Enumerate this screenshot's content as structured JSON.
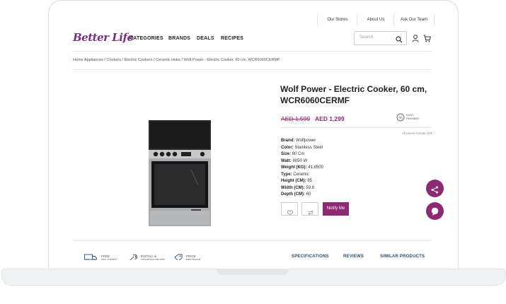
{
  "topbar": {
    "links": [
      "Our Stores",
      "About Us",
      "Ask Our Team"
    ]
  },
  "brand": {
    "logo_text": "Better Life",
    "accent_color": "#8e2a73"
  },
  "nav": {
    "items": [
      "CATEGORIES",
      "BRANDS",
      "DEALS",
      "RECIPES"
    ]
  },
  "search": {
    "placeholder": "Search"
  },
  "breadcrumb": "Home Appliances / Cookers / Electric Cookers / Ceramic Hobs / Wolf Power - Electric Cooker, 60 cm, WCR6060CERMF",
  "product": {
    "title": "Wolf Power - Electric Cooker, 60 cm, WCR6060CERMF",
    "old_price": "AED 1,599",
    "new_price": "AED 1,299",
    "easy_payment": "EASY PAYMENT",
    "vat_note": "All prices include VAT",
    "specs": [
      {
        "label": "Brand:",
        "value": "Wolfpower"
      },
      {
        "label": "Color:",
        "value": "Stainless Steel"
      },
      {
        "label": "Size:",
        "value": "60 Cm"
      },
      {
        "label": "Watt:",
        "value": "8050 W"
      },
      {
        "label": "Weight (KG):",
        "value": "41.8500"
      },
      {
        "label": "Type:",
        "value": "Ceramic"
      },
      {
        "label": "Height (CM):",
        "value": "85"
      },
      {
        "label": "Width (CM):",
        "value": "59.8"
      },
      {
        "label": "Depth (CM):",
        "value": "60"
      }
    ],
    "notify_label": "Notify Me"
  },
  "bottom": {
    "features": [
      "FREE DELIVERY",
      "INSTALL & DEMONSTRATE",
      "PRICE PROMISE"
    ],
    "tabs": [
      "SPECIFICATIONS",
      "REVIEWS",
      "SIMILAR PRODUCTS"
    ]
  }
}
